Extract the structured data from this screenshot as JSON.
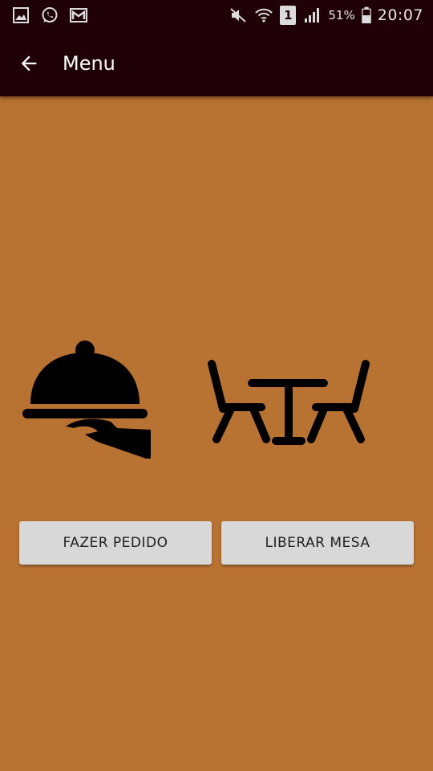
{
  "status_bar": {
    "sim_label": "1",
    "battery": "51%",
    "time": "20:07",
    "icons": [
      "gallery-icon",
      "whatsapp-icon",
      "gmail-icon",
      "mute-icon",
      "wifi-icon",
      "sim-icon",
      "signal-icon",
      "battery-icon"
    ]
  },
  "app_bar": {
    "title": "Menu",
    "back_icon": "arrow-left-icon"
  },
  "illustrations": {
    "left_icon": "serving-cloche-icon",
    "right_icon": "table-chairs-icon"
  },
  "actions": {
    "order_label": "FAZER PEDIDO",
    "release_label": "LIBERAR MESA"
  },
  "colors": {
    "background": "#B87333",
    "app_bar": "#1E0006",
    "button": "#D8D8D8",
    "icon": "#000000"
  }
}
